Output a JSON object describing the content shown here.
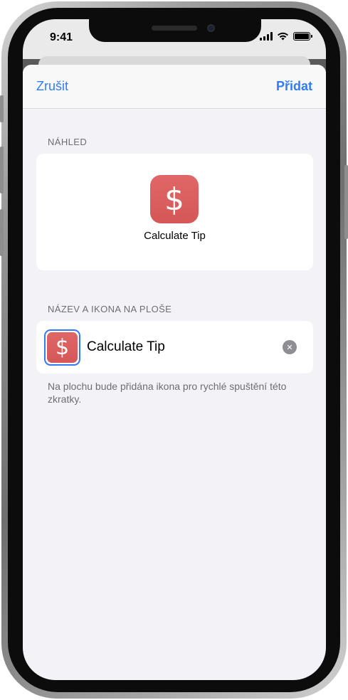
{
  "status_bar": {
    "time": "9:41",
    "battery_level": 1.0,
    "icons": [
      "signal-icon",
      "wifi-icon",
      "battery-icon"
    ]
  },
  "nav": {
    "cancel_label": "Zrušit",
    "add_label": "Přidat"
  },
  "preview_section": {
    "header": "NÁHLED",
    "icon_glyph": "$",
    "label": "Calculate Tip"
  },
  "name_section": {
    "header": "NÁZEV A IKONA NA PLOŠE",
    "icon_glyph": "$",
    "name_value": "Calculate Tip",
    "clear_glyph": "✕",
    "footer": "Na plochu bude přidána ikona pro rychlé spuštění této zkratky."
  },
  "colors": {
    "accent": "#2f7cf6",
    "icon_background": "#d85a5a",
    "sheet_background": "#f2f2f7"
  }
}
